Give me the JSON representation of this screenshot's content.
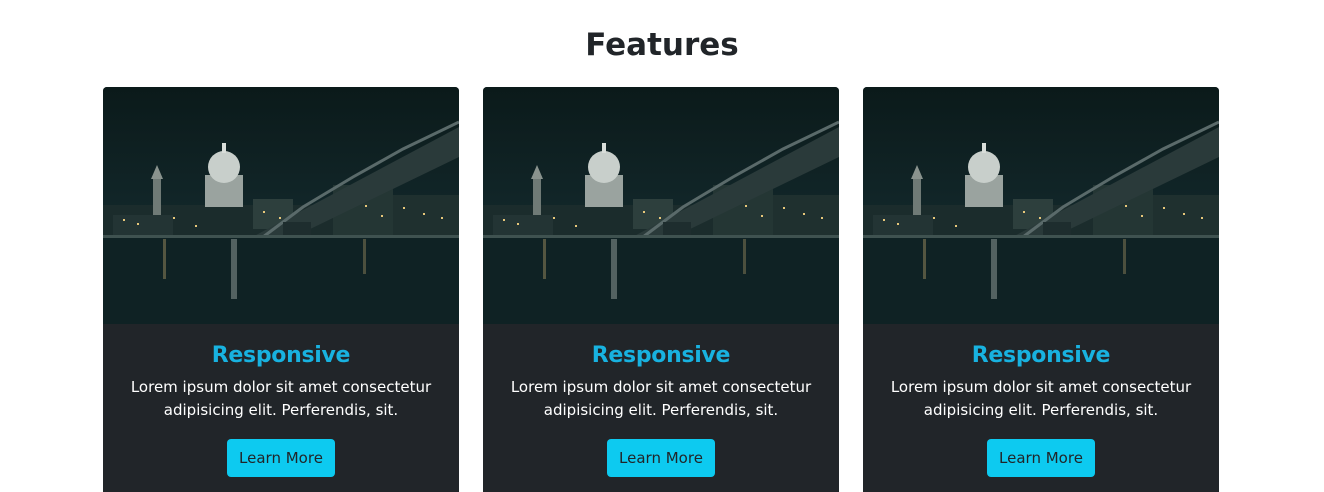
{
  "section": {
    "title": "Features"
  },
  "cards": [
    {
      "title": "Responsive",
      "text": "Lorem ipsum dolor sit amet consectetur adipisicing elit. Perferendis, sit.",
      "button_label": "Learn More",
      "image": "london-night-skyline-image"
    },
    {
      "title": "Responsive",
      "text": "Lorem ipsum dolor sit amet consectetur adipisicing elit. Perferendis, sit.",
      "button_label": "Learn More",
      "image": "london-night-skyline-image"
    },
    {
      "title": "Responsive",
      "text": "Lorem ipsum dolor sit amet consectetur adipisicing elit. Perferendis, sit.",
      "button_label": "Learn More",
      "image": "london-night-skyline-image"
    }
  ],
  "colors": {
    "card_background": "#212529",
    "title_accent": "#18b2e0",
    "button_background": "#0dcaf0",
    "heading_text": "#212529"
  }
}
